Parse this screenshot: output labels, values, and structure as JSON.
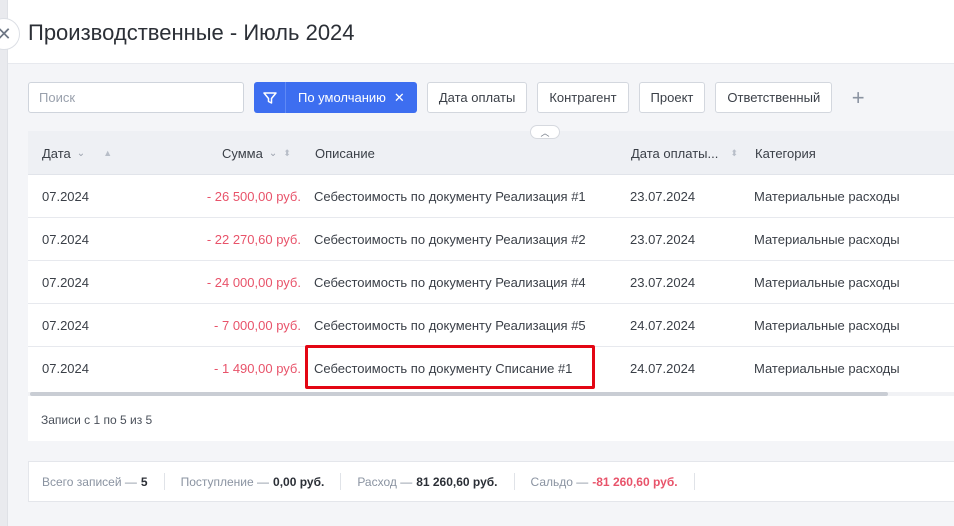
{
  "title": "Производственные - Июль 2024",
  "search": {
    "placeholder": "Поиск"
  },
  "filters": {
    "preset_label": "По умолчанию",
    "chips": [
      "Дата оплаты",
      "Контрагент",
      "Проект",
      "Ответственный"
    ]
  },
  "columns": {
    "date": "Дата",
    "sum": "Сумма",
    "desc": "Описание",
    "pay_date": "Дата оплаты...",
    "category": "Категория"
  },
  "rows": [
    {
      "date": "07.2024",
      "sum": "- 26 500,00 руб.",
      "desc": "Себестоимость по документу Реализация #1",
      "pay_date": "23.07.2024",
      "category": "Материальные расходы"
    },
    {
      "date": "07.2024",
      "sum": "- 22 270,60 руб.",
      "desc": "Себестоимость по документу Реализация #2",
      "pay_date": "23.07.2024",
      "category": "Материальные расходы"
    },
    {
      "date": "07.2024",
      "sum": "- 24 000,00 руб.",
      "desc": "Себестоимость по документу Реализация #4",
      "pay_date": "23.07.2024",
      "category": "Материальные расходы"
    },
    {
      "date": "07.2024",
      "sum": "- 7 000,00 руб.",
      "desc": "Себестоимость по документу Реализация #5",
      "pay_date": "24.07.2024",
      "category": "Материальные расходы"
    },
    {
      "date": "07.2024",
      "sum": "- 1 490,00 руб.",
      "desc": "Себестоимость по документу Списание #1",
      "pay_date": "24.07.2024",
      "category": "Материальные расходы"
    }
  ],
  "records_info": "Записи с 1 по 5 из 5",
  "summary": {
    "total_label": "Всего записей —",
    "total_value": "5",
    "income_label": "Поступление —",
    "income_value": "0,00 руб.",
    "expense_label": "Расход —",
    "expense_value": "81 260,60 руб.",
    "balance_label": "Сальдо —",
    "balance_value": "-81 260,60 руб."
  },
  "colors": {
    "accent": "#3d6ef0",
    "negative": "#e8536a",
    "highlight": "#e30613"
  },
  "icons": {
    "close": "close-icon",
    "filter": "filter-icon",
    "plus": "plus-icon",
    "collapse": "chevron-up-icon"
  }
}
